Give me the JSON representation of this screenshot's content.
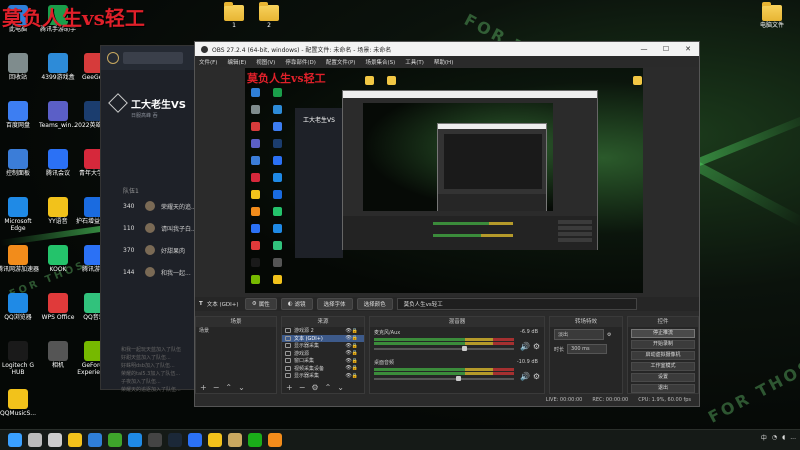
{
  "overlay_title": "莫负人生vs轻工",
  "desktop_icons_left": [
    {
      "label": "此电脑",
      "color": "#2f7fd8"
    },
    {
      "label": "腾讯手游助手",
      "color": "#1a9e4a"
    },
    {
      "label": "回收站",
      "color": "#7f8c8d"
    },
    {
      "label": "4399游戏盒",
      "color": "#2d8bd8"
    },
    {
      "label": "GeeGee",
      "color": "#d63b3b"
    },
    {
      "label": "百度网盘",
      "color": "#3d7ef2"
    },
    {
      "label": "Teams_win...",
      "color": "#5b5fc7"
    },
    {
      "label": "2022英雄联盟",
      "color": "#1b3d6e"
    },
    {
      "label": "控制面板",
      "color": "#3b7dd8"
    },
    {
      "label": "腾讯会议",
      "color": "#2b71f5"
    },
    {
      "label": "青年大学习",
      "color": "#d6283b"
    },
    {
      "label": "Microsoft Edge",
      "color": "#1f8ae6"
    },
    {
      "label": "YY语音",
      "color": "#f2c21b"
    },
    {
      "label": "护石增益插件",
      "color": "#1a6be0"
    },
    {
      "label": "腾讯网游加速器",
      "color": "#f28c1b"
    },
    {
      "label": "KOOK",
      "color": "#24c36b"
    },
    {
      "label": "腾讯游戏",
      "color": "#2b71f5"
    },
    {
      "label": "QQ浏览器",
      "color": "#1f8ae6"
    },
    {
      "label": "WPS Office",
      "color": "#e03a3a"
    },
    {
      "label": "QQ音乐",
      "color": "#31c27c"
    },
    {
      "label": "Logitech G HUB",
      "color": "#1a1a1a"
    },
    {
      "label": "相机",
      "color": "#555555"
    },
    {
      "label": "GeForce Experience",
      "color": "#76b900"
    },
    {
      "label": "QQMusicS...",
      "color": "#f2c21b"
    }
  ],
  "desktop_folders_top": [
    {
      "label": "1"
    },
    {
      "label": "2"
    }
  ],
  "desktop_right": {
    "label": "电脑文件"
  },
  "wallpaper_texts": [
    "FOR THOSE WHO DARE",
    "FOR THOSE WHO DARE",
    "FOR THOSE WHO DARE"
  ],
  "chat": {
    "title": "工大老生VS",
    "subtitle": "日服高峰 吞",
    "section": "队伍1",
    "rows": [
      {
        "num": "340",
        "name": "荣耀天的追..."
      },
      {
        "num": "110",
        "name": "请叫我子白..."
      },
      {
        "num": "370",
        "name": "好甜果肉"
      },
      {
        "num": "144",
        "name": "和我一起..."
      }
    ],
    "footer_lines": [
      "和我一起玩天蓝加入了队伍",
      "好甜天蓝加入了队伍...",
      "好蛛明dsb加入了队伍...",
      "荣耀的tal5.3加入了队伍...",
      "子夜加入了队伍...",
      "荣耀天的追逐加入了队伍..."
    ]
  },
  "obs": {
    "title": "OBS 27.2.4 (64-bit, windows) - 配置文件: 未命名 - 场景: 未命名",
    "menu": [
      "文件(F)",
      "编辑(E)",
      "视图(V)",
      "停靠部件(D)",
      "配置文件(P)",
      "场景集合(S)",
      "工具(T)",
      "帮助(H)"
    ],
    "toolbar": {
      "source_label": "文本 (GDI+)",
      "properties": "属性",
      "filters": "滤镜",
      "font": "选择字体",
      "color": "选择颜色",
      "text_value": "莫负人生vs轻工"
    },
    "scenes": {
      "header": "场景",
      "items": [
        "场景"
      ]
    },
    "sources": {
      "header": "来源",
      "items": [
        {
          "label": "游戏源 2",
          "selected": false
        },
        {
          "label": "文本 (GDI+)",
          "selected": true
        },
        {
          "label": "显示器采集",
          "selected": false
        },
        {
          "label": "游戏源",
          "selected": false
        },
        {
          "label": "窗口采集",
          "selected": false
        },
        {
          "label": "视频采集设备",
          "selected": false
        },
        {
          "label": "显示器采集",
          "selected": false
        }
      ]
    },
    "mixer": {
      "header": "混音器",
      "channels": [
        {
          "name": "麦克风/Aux",
          "db": "-6.9 dB"
        },
        {
          "name": "桌面音频",
          "db": "-10.9 dB"
        }
      ]
    },
    "transitions": {
      "header": "转场特效",
      "type": "淡出",
      "duration_label": "时长",
      "duration": "300 ms"
    },
    "controls": {
      "header": "控件",
      "buttons": [
        "停止推流",
        "开始录制",
        "启动虚拟摄像机",
        "工作室模式",
        "设置",
        "退出"
      ]
    },
    "status": {
      "live": "LIVE: 00:00:00",
      "rec": "REC: 00:00:00",
      "cpu": "CPU: 1.9%, 60.00 fps"
    }
  },
  "taskbar": {
    "icons": [
      {
        "name": "windows-start",
        "color": "#3aa0ff"
      },
      {
        "name": "search",
        "color": "#bbbbbb"
      },
      {
        "name": "task-view",
        "color": "#cccccc"
      },
      {
        "name": "file-explorer",
        "color": "#f2c21b"
      },
      {
        "name": "store",
        "color": "#2f7fd8"
      },
      {
        "name": "xbox",
        "color": "#3ea52b"
      },
      {
        "name": "edge",
        "color": "#1f8ae6"
      },
      {
        "name": "obs",
        "color": "#444444"
      },
      {
        "name": "steam",
        "color": "#1b2838"
      },
      {
        "name": "tencent-meeting",
        "color": "#2b71f5"
      },
      {
        "name": "qq-music",
        "color": "#f2c21b"
      },
      {
        "name": "league",
        "color": "#c8a860"
      },
      {
        "name": "wechat",
        "color": "#1aad19"
      },
      {
        "name": "app",
        "color": "#f28c1b"
      }
    ],
    "tray": {
      "ime": "中",
      "time": "..."
    }
  }
}
